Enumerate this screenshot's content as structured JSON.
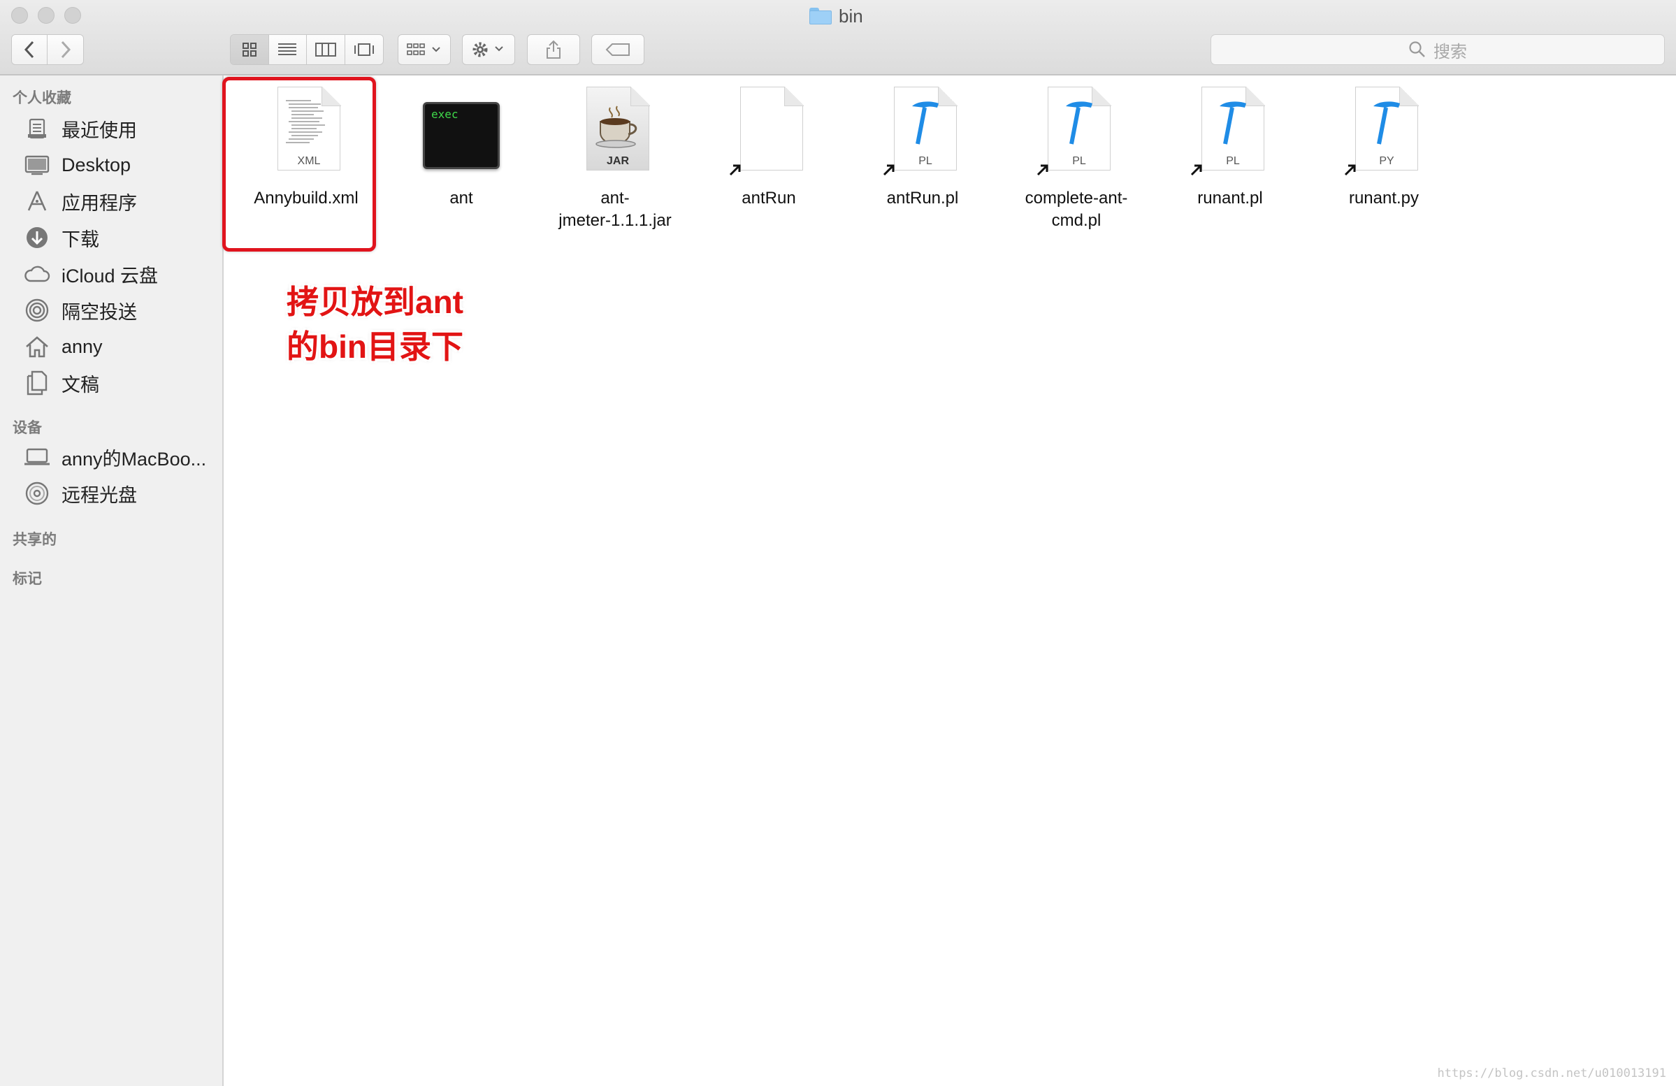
{
  "window": {
    "title": "bin"
  },
  "toolbar": {
    "search_placeholder": "搜索"
  },
  "sidebar": {
    "favorites_header": "个人收藏",
    "favorites": [
      {
        "label": "最近使用",
        "icon": "recents-icon"
      },
      {
        "label": "Desktop",
        "icon": "desktop-icon"
      },
      {
        "label": "应用程序",
        "icon": "applications-icon"
      },
      {
        "label": "下载",
        "icon": "downloads-icon"
      },
      {
        "label": "iCloud 云盘",
        "icon": "icloud-icon"
      },
      {
        "label": "隔空投送",
        "icon": "airdrop-icon"
      },
      {
        "label": "anny",
        "icon": "home-icon"
      },
      {
        "label": "文稿",
        "icon": "documents-icon"
      }
    ],
    "devices_header": "设备",
    "devices": [
      {
        "label": "anny的MacBoo...",
        "icon": "laptop-icon"
      },
      {
        "label": "远程光盘",
        "icon": "disc-icon"
      }
    ],
    "shared_header": "共享的",
    "tags_header": "标记"
  },
  "files": [
    {
      "name": "Annybuild.xml",
      "kind": "XML"
    },
    {
      "name": "ant",
      "kind": "exec"
    },
    {
      "name": "ant-\njmeter-1.1.1.jar",
      "kind": "JAR"
    },
    {
      "name": "antRun",
      "kind": "blank"
    },
    {
      "name": "antRun.pl",
      "kind": "PL"
    },
    {
      "name": "complete-ant-\ncmd.pl",
      "kind": "PL"
    },
    {
      "name": "runant.pl",
      "kind": "PL"
    },
    {
      "name": "runant.py",
      "kind": "PY"
    }
  ],
  "annotation": {
    "line1": "拷贝放到ant",
    "line2": "的bin目录下"
  },
  "watermark": "https://blog.csdn.net/u010013191"
}
